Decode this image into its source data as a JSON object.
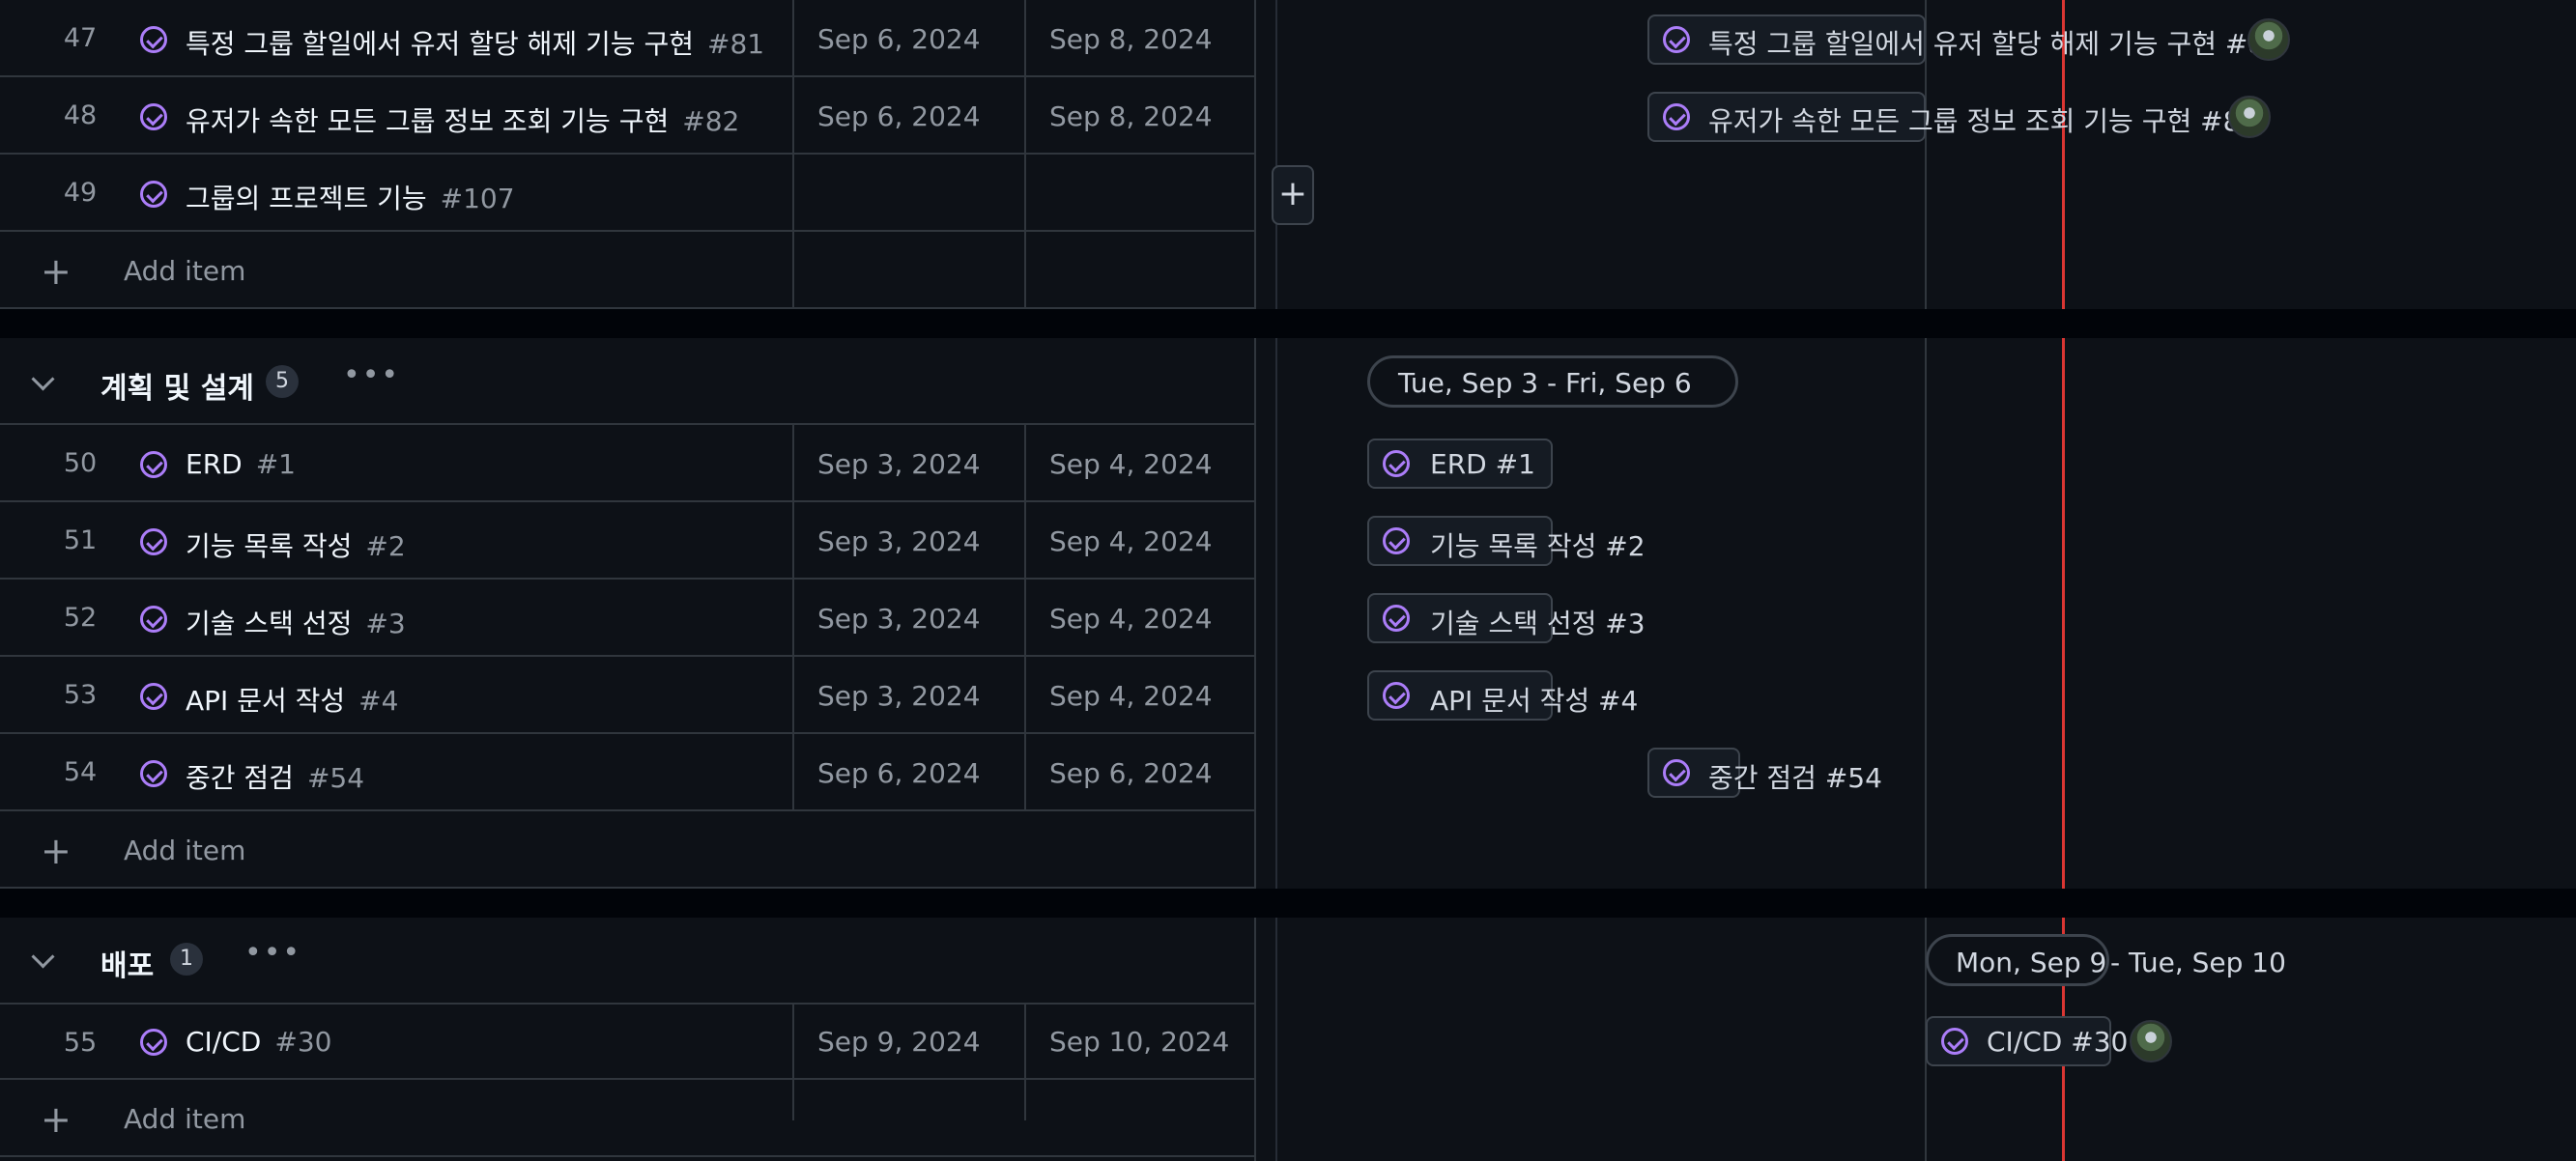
{
  "timeline": {
    "today_marker_color": "#da3633",
    "accent_color": "#ab7df8"
  },
  "groups": [
    {
      "name": "",
      "rows": [
        {
          "num": "47",
          "title": "특정 그룹 할일에서 유저 할당 해제 기능 구현",
          "issue": "#81",
          "start": "Sep 6, 2024",
          "end": "Sep 8, 2024",
          "bar_label": "특정 그룹 할일에서 유저 할당 해제 기능 구현 #81"
        },
        {
          "num": "48",
          "title": "유저가 속한 모든 그룹 정보 조회 기능 구현",
          "issue": "#82",
          "start": "Sep 6, 2024",
          "end": "Sep 8, 2024",
          "bar_label": "유저가 속한 모든 그룹 정보 조회 기능 구현 #82"
        },
        {
          "num": "49",
          "title": "그룹의 프로젝트 기능",
          "issue": "#107",
          "start": "",
          "end": "",
          "bar_label": ""
        }
      ],
      "add_item": "Add item"
    },
    {
      "name": "계획 및 설계",
      "count": "5",
      "date_range": "Tue, Sep 3 - Fri, Sep 6",
      "rows": [
        {
          "num": "50",
          "title": "ERD",
          "issue": "#1",
          "start": "Sep 3, 2024",
          "end": "Sep 4, 2024",
          "bar_label": "ERD #1"
        },
        {
          "num": "51",
          "title": "기능 목록 작성",
          "issue": "#2",
          "start": "Sep 3, 2024",
          "end": "Sep 4, 2024",
          "bar_label": "기능 목록 작성 #2"
        },
        {
          "num": "52",
          "title": "기술 스택 선정",
          "issue": "#3",
          "start": "Sep 3, 2024",
          "end": "Sep 4, 2024",
          "bar_label": "기술 스택 선정 #3"
        },
        {
          "num": "53",
          "title": "API 문서 작성",
          "issue": "#4",
          "start": "Sep 3, 2024",
          "end": "Sep 4, 2024",
          "bar_label": "API 문서 작성 #4"
        },
        {
          "num": "54",
          "title": "중간 점검",
          "issue": "#54",
          "start": "Sep 6, 2024",
          "end": "Sep 6, 2024",
          "bar_label": "중간 점검 #54"
        }
      ],
      "add_item": "Add item"
    },
    {
      "name": "배포",
      "count": "1",
      "date_range_start": "Mon, Sep 9",
      "date_range_end": "- Tue, Sep 10",
      "rows": [
        {
          "num": "55",
          "title": "CI/CD",
          "issue": "#30",
          "start": "Sep 9, 2024",
          "end": "Sep 10, 2024",
          "bar_label": "CI/CD #30"
        }
      ],
      "add_item": "Add item"
    }
  ],
  "icons": {
    "status": "issue-closed-icon",
    "add": "plus-icon",
    "collapse": "chevron-down-icon",
    "menu": "kebab-horizontal-icon",
    "assignee": "avatar"
  }
}
